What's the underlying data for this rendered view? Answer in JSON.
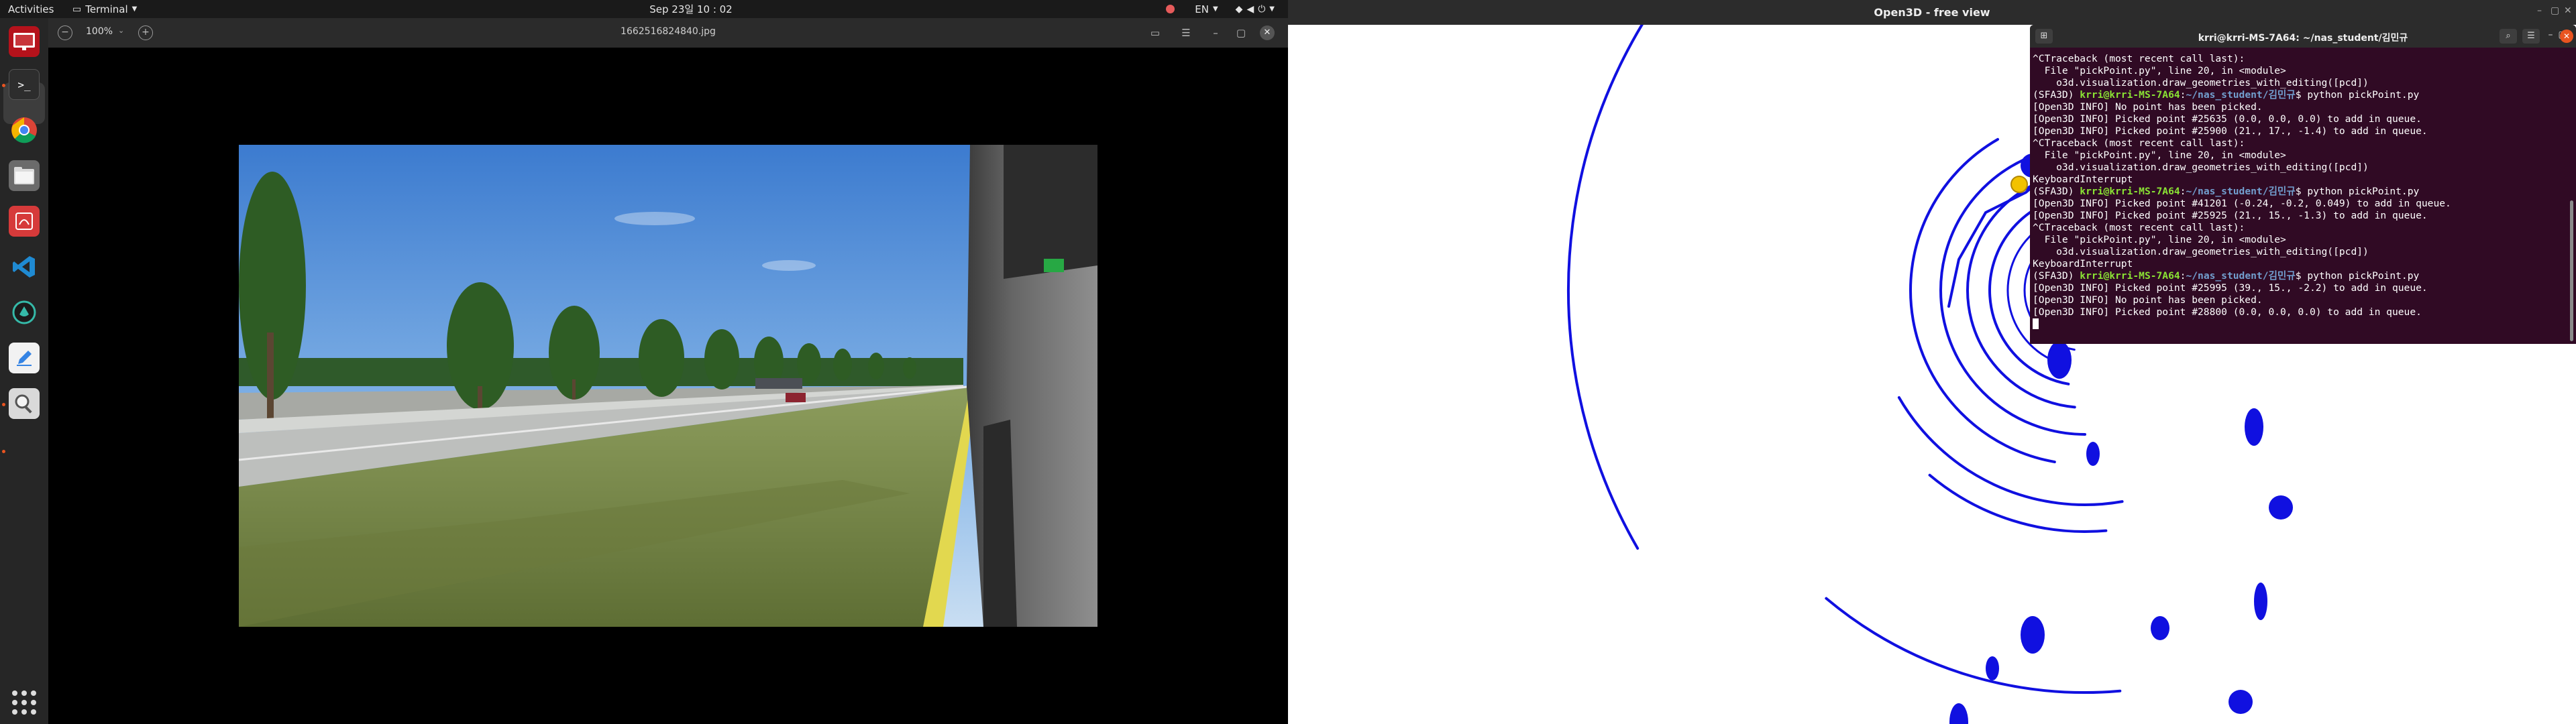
{
  "topbar": {
    "activities": "Activities",
    "app_name": "Terminal",
    "clock": "Sep 23일  10 : 02",
    "lang": "EN"
  },
  "dock": {
    "icons": [
      "libreoffice-impress-icon",
      "terminal-icon",
      "chrome-icon",
      "files-icon",
      "document-viewer-icon",
      "vscode-icon",
      "inkscape-icon",
      "text-editor-icon",
      "image-viewer-icon",
      "show-apps-icon"
    ]
  },
  "viewer": {
    "zoom": "100%",
    "filename": "1662516824840.jpg"
  },
  "open3d": {
    "title": "Open3D - free view"
  },
  "terminal": {
    "title": "krri@krri-MS-7A64: ~/nas_student/김민규",
    "lines": [
      {
        "t": "^CTraceback (most recent call last):"
      },
      {
        "t": "  File \"pickPoint.py\", line 20, in <module>"
      },
      {
        "t": "    o3d.visualization.draw_geometries_with_editing([pcd])"
      },
      {
        "env": "(SFA3D) ",
        "user": "krri@krri-MS-7A64",
        "sep": ":",
        "path": "~/nas_student/김민규",
        "cmd": "$ python pickPoint.py"
      },
      {
        "t": "[Open3D INFO] No point has been picked."
      },
      {
        "t": "[Open3D INFO] Picked point #25635 (0.0, 0.0, 0.0) to add in queue."
      },
      {
        "t": "[Open3D INFO] Picked point #25900 (21., 17., -1.4) to add in queue."
      },
      {
        "t": "^CTraceback (most recent call last):"
      },
      {
        "t": "  File \"pickPoint.py\", line 20, in <module>"
      },
      {
        "t": "    o3d.visualization.draw_geometries_with_editing([pcd])"
      },
      {
        "t": "KeyboardInterrupt"
      },
      {
        "env": "(SFA3D) ",
        "user": "krri@krri-MS-7A64",
        "sep": ":",
        "path": "~/nas_student/김민규",
        "cmd": "$ python pickPoint.py"
      },
      {
        "t": "[Open3D INFO] Picked point #41201 (-0.24, -0.2, 0.049) to add in queue."
      },
      {
        "t": "[Open3D INFO] Picked point #25925 (21., 15., -1.3) to add in queue."
      },
      {
        "t": "^CTraceback (most recent call last):"
      },
      {
        "t": "  File \"pickPoint.py\", line 20, in <module>"
      },
      {
        "t": "    o3d.visualization.draw_geometries_with_editing([pcd])"
      },
      {
        "t": "KeyboardInterrupt"
      },
      {
        "env": "(SFA3D) ",
        "user": "krri@krri-MS-7A64",
        "sep": ":",
        "path": "~/nas_student/김민규",
        "cmd": "$ python pickPoint.py"
      },
      {
        "t": "[Open3D INFO] Picked point #25995 (39., 15., -2.2) to add in queue."
      },
      {
        "t": "[Open3D INFO] No point has been picked."
      },
      {
        "t": "[Open3D INFO] Picked point #28800 (0.0, 0.0, 0.0) to add in queue."
      }
    ]
  },
  "colors": {
    "pointcloud": "#1010e0",
    "terminal_bg": "#300a24",
    "picked_point_yellow": "#f2c200",
    "picked_point_cyan": "#00b0d8",
    "accent": "#e95420"
  }
}
